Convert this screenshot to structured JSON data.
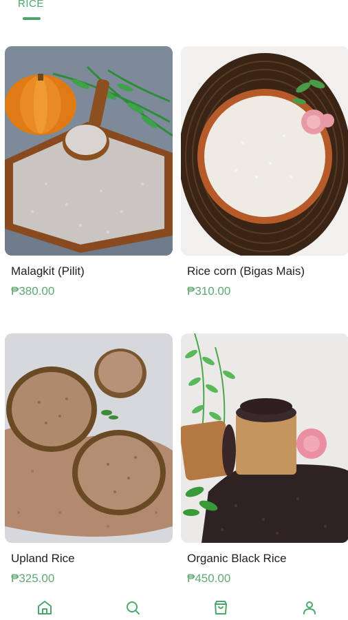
{
  "tabs": {
    "active_label": "RICE"
  },
  "products": [
    {
      "name": "Malagkit (Pilit)",
      "price": "₱380.00"
    },
    {
      "name": "Rice corn (Bigas Mais)",
      "price": "₱310.00"
    },
    {
      "name": "Upland Rice",
      "price": "₱325.00"
    },
    {
      "name": "Organic Black Rice",
      "price": "₱450.00"
    }
  ],
  "bottom_nav": {
    "items": [
      {
        "icon": "home-icon"
      },
      {
        "icon": "search-icon"
      },
      {
        "icon": "cart-icon"
      },
      {
        "icon": "profile-icon"
      }
    ]
  },
  "colors": {
    "accent": "#4aa66a",
    "price": "#5fa874"
  }
}
